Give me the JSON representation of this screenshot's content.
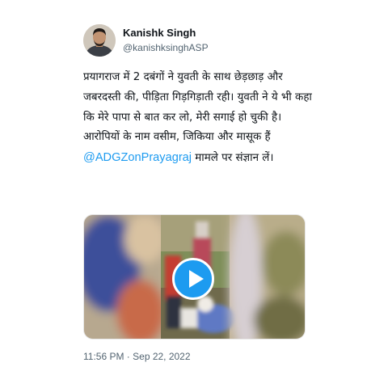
{
  "author": {
    "display_name": "Kanishk Singh",
    "handle": "@kanishksinghASP"
  },
  "tweet": {
    "text_before_mention": "प्रयागराज में 2 दबंगों ने युवती के साथ छेड़छाड़ और जबरदस्ती की, पीड़िता गिड़गिड़ाती रही। युवती ने ये भी कहा कि मेरे पापा से बात कर लो, मेरी सगाई हो चुकी है। आरोपियों के नाम वसीम, जिकिया और मासूक हैं ",
    "mention": "@ADGZonPrayagraj",
    "text_after_mention": " मामले पर संज्ञान लें।",
    "timestamp": "11:56 PM · Sep 22, 2022"
  },
  "media": {
    "type": "video",
    "play_icon": "play-icon"
  },
  "colors": {
    "accent": "#1d9bf0",
    "secondary_text": "#536471",
    "primary_text": "#0f1419"
  }
}
